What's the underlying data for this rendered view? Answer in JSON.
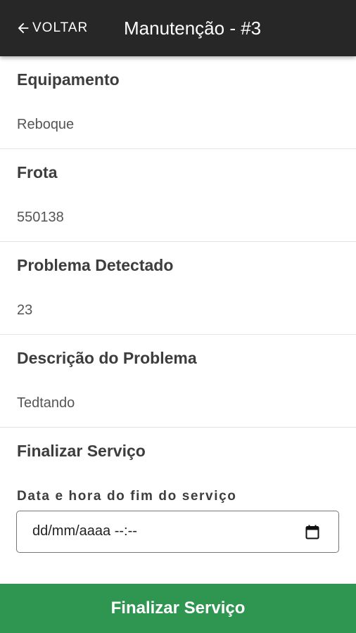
{
  "header": {
    "back_label": "VOLTAR",
    "back_icon": "arrow-left-icon",
    "title": "Manutenção - #3"
  },
  "fields": [
    {
      "label": "Equipamento",
      "value": "Reboque"
    },
    {
      "label": "Frota",
      "value": "550138"
    },
    {
      "label": "Problema Detectado",
      "value": "23"
    },
    {
      "label": "Descrição do Problema",
      "value": "Tedtando"
    }
  ],
  "finalize": {
    "heading": "Finalizar Serviço",
    "datetime_label": "Data e hora do fim do serviço",
    "datetime_placeholder": "dd/mm/aaaa --:--",
    "calendar_icon": "calendar-icon"
  },
  "submit_button": {
    "label": "Finalizar Serviço"
  },
  "colors": {
    "header_background": "#272727",
    "primary_button": "#2e9650",
    "divider": "#e3e3e3"
  }
}
